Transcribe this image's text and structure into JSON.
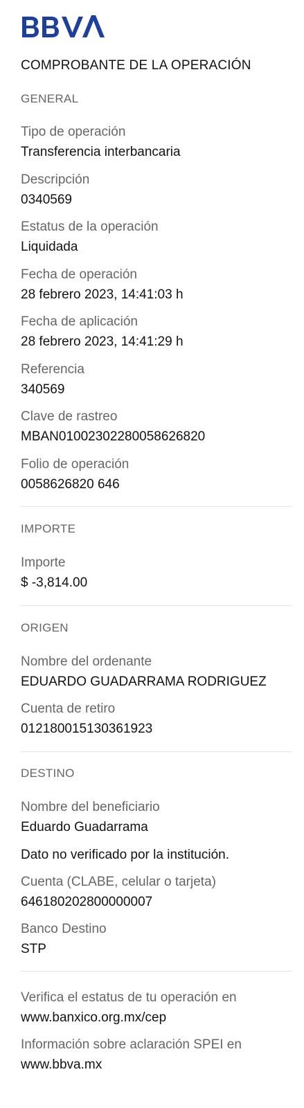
{
  "header": {
    "brand": "BBVA",
    "brand_color": "#1d3f9e",
    "title": "COMPROBANTE DE LA OPERACIÓN"
  },
  "general": {
    "section_title": "GENERAL",
    "tipo_label": "Tipo de operación",
    "tipo_value": "Transferencia interbancaria",
    "descripcion_label": "Descripción",
    "descripcion_value": "0340569",
    "estatus_label": "Estatus de la operación",
    "estatus_value": "Liquidada",
    "fecha_op_label": "Fecha de operación",
    "fecha_op_value": "28 febrero 2023, 14:41:03 h",
    "fecha_ap_label": "Fecha de aplicación",
    "fecha_ap_value": "28 febrero 2023, 14:41:29 h",
    "referencia_label": "Referencia",
    "referencia_value": "340569",
    "clave_label": "Clave de rastreo",
    "clave_value": "MBAN01002302280058626820",
    "folio_label": "Folio de operación",
    "folio_value": "0058626820 646"
  },
  "importe": {
    "section_title": "IMPORTE",
    "importe_label": "Importe",
    "importe_value": "$ -3,814.00"
  },
  "origen": {
    "section_title": "ORIGEN",
    "ordenante_label": "Nombre del ordenante",
    "ordenante_value": "EDUARDO GUADARRAMA RODRIGUEZ",
    "cuenta_label": "Cuenta de retiro",
    "cuenta_value": "012180015130361923"
  },
  "destino": {
    "section_title": "DESTINO",
    "beneficiario_label": "Nombre del beneficiario",
    "beneficiario_value": "Eduardo Guadarrama",
    "nota": "Dato no verificado por la institución.",
    "cuenta_label": "Cuenta (CLABE, celular o tarjeta)",
    "cuenta_value": "646180202800000007",
    "banco_label": "Banco Destino",
    "banco_value": "STP"
  },
  "footer": {
    "verifica_text": "Verifica el estatus de tu operación en",
    "verifica_link": "www.banxico.org.mx/cep",
    "aclaracion_text": "Información sobre aclaración SPEI en",
    "aclaracion_link": "www.bbva.mx"
  }
}
